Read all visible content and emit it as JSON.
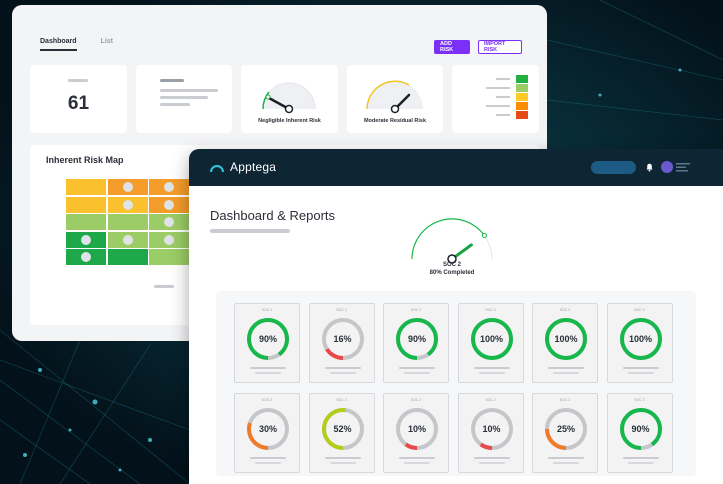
{
  "back": {
    "tabs": [
      {
        "label": "Dashboard",
        "active": true
      },
      {
        "label": "List",
        "active": false
      }
    ],
    "add_risk_label": "ADD RISK",
    "import_risk_label": "IMPORT RISK",
    "risk_count": "61",
    "inherent_gauge_label": "Negligible Inherent Risk",
    "residual_gauge_label": "Moderate Residual Risk",
    "legend_colors": [
      "#1fb141",
      "#9ccc65",
      "#ffca28",
      "#fb8c00",
      "#e64a19"
    ],
    "heat_map_title": "Inherent Risk Map",
    "heat_rows": [
      [
        "#fbc02d",
        "#f59d2a",
        "#f59d2a",
        "#e65a12",
        "#e65a12",
        "#e65a12"
      ],
      [
        "#fbc02d",
        "#fbc02d",
        "#f59d2a",
        "#f59d2a",
        "#e65a12",
        "#e65a12"
      ],
      [
        "#9ccc65",
        "#9ccc65",
        "#9ccc65",
        "#f59d2a",
        "#f59d2a",
        "#e65a12"
      ],
      [
        "#1fa84a",
        "#9ccc65",
        "#9ccc65",
        "#fbc02d",
        "#f59d2a",
        "#f59d2a"
      ],
      [
        "#1fa84a",
        "#1fa84a",
        "#9ccc65",
        "#9ccc65",
        "#fbc02d",
        "#f59d2a"
      ]
    ]
  },
  "front": {
    "brand": "Apptega",
    "page_title": "Dashboard & Reports",
    "soc_name": "SOC 2",
    "soc_progress": "80% Completed",
    "soc_progress_value": 0.8,
    "rings": [
      {
        "caption": "SOC 2",
        "label": "90%",
        "value": 90,
        "color": "#16b84b"
      },
      {
        "caption": "SOC 2",
        "label": "16%",
        "value": 16,
        "color": "#e84a4a"
      },
      {
        "caption": "SOC 2",
        "label": "90%",
        "value": 90,
        "color": "#16b84b"
      },
      {
        "caption": "SOC 2",
        "label": "100%",
        "value": 100,
        "color": "#16b84b"
      },
      {
        "caption": "SOC 2",
        "label": "100%",
        "value": 100,
        "color": "#16b84b"
      },
      {
        "caption": "SOC 2",
        "label": "100%",
        "value": 100,
        "color": "#16b84b"
      },
      {
        "caption": "SOC 2",
        "label": "30%",
        "value": 30,
        "color": "#f07a2a"
      },
      {
        "caption": "SOC 2",
        "label": "52%",
        "value": 52,
        "color": "#b5cc1d"
      },
      {
        "caption": "SOC 2",
        "label": "10%",
        "value": 10,
        "color": "#e84a4a"
      },
      {
        "caption": "SOC 2",
        "label": "10%",
        "value": 10,
        "color": "#e84a4a"
      },
      {
        "caption": "SOC 2",
        "label": "25%",
        "value": 25,
        "color": "#f07a2a"
      },
      {
        "caption": "SOC 2",
        "label": "90%",
        "value": 90,
        "color": "#16b84b"
      }
    ]
  }
}
